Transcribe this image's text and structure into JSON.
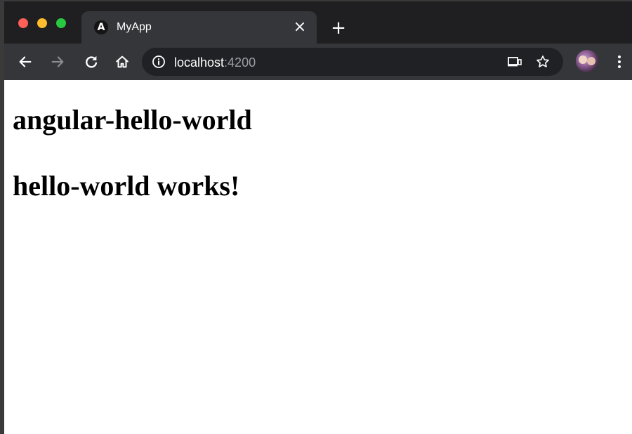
{
  "window": {
    "tab": {
      "favicon_letter": "A",
      "title": "MyApp",
      "close_glyph": "×"
    },
    "new_tab_glyph": "+",
    "toolbar": {
      "back_icon": "arrow-left-icon",
      "forward_icon": "arrow-right-icon",
      "reload_icon": "reload-icon",
      "home_icon": "home-icon",
      "omnibox": {
        "host": "localhost",
        "port": ":4200"
      }
    }
  },
  "page": {
    "app_heading": "angular-hello-world",
    "component_heading": "hello-world works!"
  },
  "colors": {
    "tabstrip": "#1f1f21",
    "toolbar": "#35363a",
    "omnibox": "#202124",
    "traffic_red": "#fe5f57",
    "traffic_yellow": "#febc2e",
    "traffic_green": "#29c840"
  }
}
